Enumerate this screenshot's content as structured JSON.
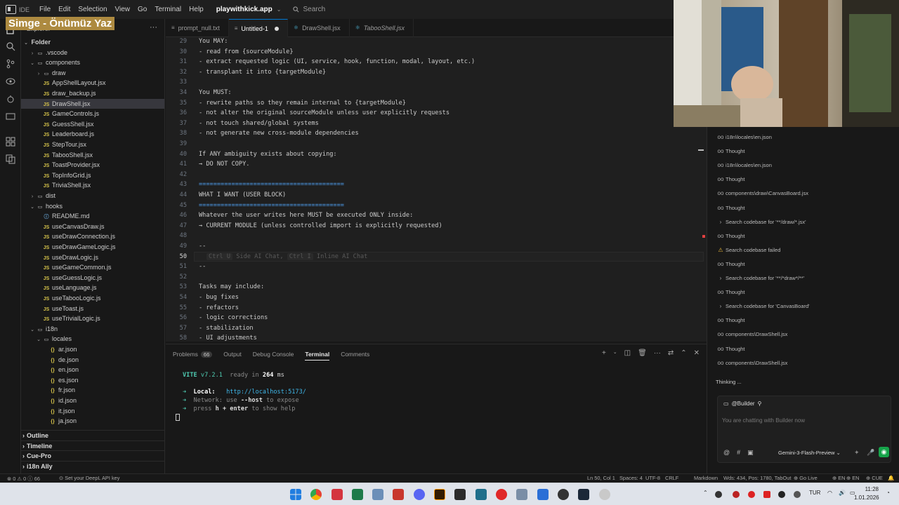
{
  "titlebar": {
    "ide_label": "IDE",
    "menu": [
      "File",
      "Edit",
      "Selection",
      "View",
      "Go",
      "Terminal",
      "Help"
    ],
    "project": "playwithkick.app",
    "search_placeholder": "Search"
  },
  "overlay_caption": "Simge - Önümüz Yaz",
  "sidebar": {
    "header": "Explorer",
    "more": "···",
    "root": "Folder",
    "items": [
      {
        "label": ".vscode",
        "kind": "folder",
        "depth": 1,
        "open": false
      },
      {
        "label": "components",
        "kind": "folder",
        "depth": 1,
        "open": true
      },
      {
        "label": "draw",
        "kind": "folder",
        "depth": 2,
        "open": false
      },
      {
        "label": "AppShellLayout.jsx",
        "kind": "js",
        "depth": 2
      },
      {
        "label": "draw_backup.js",
        "kind": "js",
        "depth": 2
      },
      {
        "label": "DrawShell.jsx",
        "kind": "js",
        "depth": 2,
        "selected": true
      },
      {
        "label": "GameControls.js",
        "kind": "js",
        "depth": 2
      },
      {
        "label": "GuessShell.jsx",
        "kind": "js",
        "depth": 2
      },
      {
        "label": "Leaderboard.js",
        "kind": "js",
        "depth": 2
      },
      {
        "label": "StepTour.jsx",
        "kind": "js",
        "depth": 2
      },
      {
        "label": "TabooShell.jsx",
        "kind": "js",
        "depth": 2
      },
      {
        "label": "ToastProvider.jsx",
        "kind": "js",
        "depth": 2
      },
      {
        "label": "TopInfoGrid.js",
        "kind": "js",
        "depth": 2
      },
      {
        "label": "TriviaShell.jsx",
        "kind": "js",
        "depth": 2
      },
      {
        "label": "dist",
        "kind": "folder",
        "depth": 1,
        "open": false
      },
      {
        "label": "hooks",
        "kind": "folder",
        "depth": 1,
        "open": true
      },
      {
        "label": "README.md",
        "kind": "md",
        "depth": 2
      },
      {
        "label": "useCanvasDraw.js",
        "kind": "js",
        "depth": 2
      },
      {
        "label": "useDrawConnection.js",
        "kind": "js",
        "depth": 2
      },
      {
        "label": "useDrawGameLogic.js",
        "kind": "js",
        "depth": 2
      },
      {
        "label": "useDrawLogic.js",
        "kind": "js",
        "depth": 2
      },
      {
        "label": "useGameCommon.js",
        "kind": "js",
        "depth": 2
      },
      {
        "label": "useGuessLogic.js",
        "kind": "js",
        "depth": 2
      },
      {
        "label": "useLanguage.js",
        "kind": "js",
        "depth": 2
      },
      {
        "label": "useTabooLogic.js",
        "kind": "js",
        "depth": 2
      },
      {
        "label": "useToast.js",
        "kind": "js",
        "depth": 2
      },
      {
        "label": "useTrivialLogic.js",
        "kind": "js",
        "depth": 2
      },
      {
        "label": "i18n",
        "kind": "folder",
        "depth": 1,
        "open": true
      },
      {
        "label": "locales",
        "kind": "folder",
        "depth": 2,
        "open": true
      },
      {
        "label": "ar.json",
        "kind": "json",
        "depth": 3
      },
      {
        "label": "de.json",
        "kind": "json",
        "depth": 3
      },
      {
        "label": "en.json",
        "kind": "json",
        "depth": 3
      },
      {
        "label": "es.json",
        "kind": "json",
        "depth": 3
      },
      {
        "label": "fr.json",
        "kind": "json",
        "depth": 3
      },
      {
        "label": "id.json",
        "kind": "json",
        "depth": 3
      },
      {
        "label": "it.json",
        "kind": "json",
        "depth": 3
      },
      {
        "label": "ja.json",
        "kind": "json",
        "depth": 3
      }
    ],
    "sections": [
      "Outline",
      "Timeline",
      "Cue-Pro",
      "i18n Ally"
    ]
  },
  "tabs": [
    {
      "label": "prompt_null.txt",
      "icon": "≡",
      "active": false,
      "italic": false,
      "dirty": false
    },
    {
      "label": "Untitled-1",
      "icon": "≡",
      "active": true,
      "italic": false,
      "dirty": true
    },
    {
      "label": "DrawShell.jsx",
      "icon": "⚛",
      "active": false,
      "italic": false,
      "dirty": false
    },
    {
      "label": "TabooShell.jsx",
      "icon": "⚛",
      "active": false,
      "italic": true,
      "dirty": false
    }
  ],
  "editor": {
    "current_line": "50",
    "lines": [
      {
        "n": "29",
        "t": "You MAY:"
      },
      {
        "n": "30",
        "t": "- read from {sourceModule}"
      },
      {
        "n": "31",
        "t": "- extract requested logic (UI, service, hook, function, modal, layout, etc.)"
      },
      {
        "n": "32",
        "t": "- transplant it into {targetModule}"
      },
      {
        "n": "33",
        "t": ""
      },
      {
        "n": "34",
        "t": "You MUST:"
      },
      {
        "n": "35",
        "t": "- rewrite paths so they remain internal to {targetModule}"
      },
      {
        "n": "36",
        "t": "- not alter the original sourceModule unless user explicitly requests"
      },
      {
        "n": "37",
        "t": "- not touch shared/global systems"
      },
      {
        "n": "38",
        "t": "- not generate new cross-module dependencies"
      },
      {
        "n": "39",
        "t": ""
      },
      {
        "n": "40",
        "t": "If ANY ambiguity exists about copying:"
      },
      {
        "n": "41",
        "t": "→ DO NOT COPY."
      },
      {
        "n": "42",
        "t": ""
      },
      {
        "n": "43",
        "t": "========================================",
        "sep": true
      },
      {
        "n": "44",
        "t": "WHAT I WANT (USER BLOCK)"
      },
      {
        "n": "45",
        "t": "========================================",
        "sep": true
      },
      {
        "n": "46",
        "t": "Whatever the user writes here MUST be executed ONLY inside:"
      },
      {
        "n": "47",
        "t": "→ CURRENT MODULE (unless controlled import is explicitly requested)"
      },
      {
        "n": "48",
        "t": ""
      },
      {
        "n": "49",
        "t": "--"
      },
      {
        "n": "50",
        "t": ""
      },
      {
        "n": "51",
        "t": "--"
      },
      {
        "n": "52",
        "t": ""
      },
      {
        "n": "53",
        "t": "Tasks may include:"
      },
      {
        "n": "54",
        "t": "- bug fixes"
      },
      {
        "n": "55",
        "t": "- refactors"
      },
      {
        "n": "56",
        "t": "- logic corrections"
      },
      {
        "n": "57",
        "t": "- stabilization"
      },
      {
        "n": "58",
        "t": "- UI adjustments"
      }
    ],
    "hint": {
      "k1": "Ctrl U",
      "t1": "Side AI Chat,",
      "k2": "Ctrl I",
      "t2": "Inline AI Chat"
    }
  },
  "panel": {
    "tabs": [
      {
        "label": "Problems",
        "badge": "66",
        "active": false
      },
      {
        "label": "Output",
        "active": false
      },
      {
        "label": "Debug Console",
        "active": false
      },
      {
        "label": "Terminal",
        "active": true
      },
      {
        "label": "Comments",
        "active": false
      }
    ],
    "terminal": {
      "vite": "VITE",
      "version": "v7.2.1",
      "ready": "ready in",
      "ms_value": "264",
      "ms_unit": "ms",
      "local_label": "Local:",
      "local_url": "http://localhost:5173/",
      "network_label": "Network:",
      "network_pre": "use",
      "network_flag": "--host",
      "network_post": "to expose",
      "help_pre": "press",
      "help_key": "h + enter",
      "help_post": "to show help"
    }
  },
  "ai_panel": {
    "rows": [
      {
        "icon": "oo",
        "text": "i18n\\locales\\en.json"
      },
      {
        "icon": "oo",
        "text": "Thought"
      },
      {
        "icon": "oo",
        "text": "i18n\\locales\\en.json"
      },
      {
        "icon": "oo",
        "text": "Thought"
      },
      {
        "icon": "oo",
        "text": "components\\draw\\CanvasBoard.jsx"
      },
      {
        "icon": "oo",
        "text": "Thought"
      },
      {
        "icon": "›",
        "text": "Search codebase for '**/draw/*.jsx'"
      },
      {
        "icon": "oo",
        "text": "Thought"
      },
      {
        "icon": "⚠",
        "text": "Search codebase failed",
        "warn": true
      },
      {
        "icon": "oo",
        "text": "Thought"
      },
      {
        "icon": "›",
        "text": "Search codebase for '**/*draw*/**'"
      },
      {
        "icon": "oo",
        "text": "Thought"
      },
      {
        "icon": "›",
        "text": "Search codebase for 'CanvasBoard'"
      },
      {
        "icon": "oo",
        "text": "Thought"
      },
      {
        "icon": "oo",
        "text": "components\\DrawShell.jsx"
      },
      {
        "icon": "oo",
        "text": "Thought"
      },
      {
        "icon": "oo",
        "text": "components\\DrawShell.jsx"
      }
    ],
    "thinking": "Thinking ...",
    "chat_mention": "@Builder",
    "chat_placeholder": "You are chatting with Builder now",
    "model": "Gemini-3-Flash-Preview"
  },
  "statusbar": {
    "errors": "0",
    "warnings": "0",
    "infos": "66",
    "deepl": "Set your DeepL API key",
    "position": "Ln 50, Col 1",
    "spaces": "Spaces: 4",
    "encoding": "UTF-8",
    "eol": "CRLF",
    "language": "Markdown",
    "stats": "Wds: 434, Pos: 1780, TabOut",
    "golive": "Go Live",
    "locale1": "EN",
    "locale2": "EN",
    "cue": "CUE"
  },
  "taskbar": {
    "lang": "TUR",
    "time": "11:28",
    "date": "1.01.2026"
  },
  "colors": {
    "accent": "#0078d4",
    "editor_bg": "#1f1f1f",
    "sidebar_bg": "#181818",
    "vite_green": "#4ec9b0",
    "url_cyan": "#3fb6e8",
    "caption_bg": "#ad8a40"
  }
}
